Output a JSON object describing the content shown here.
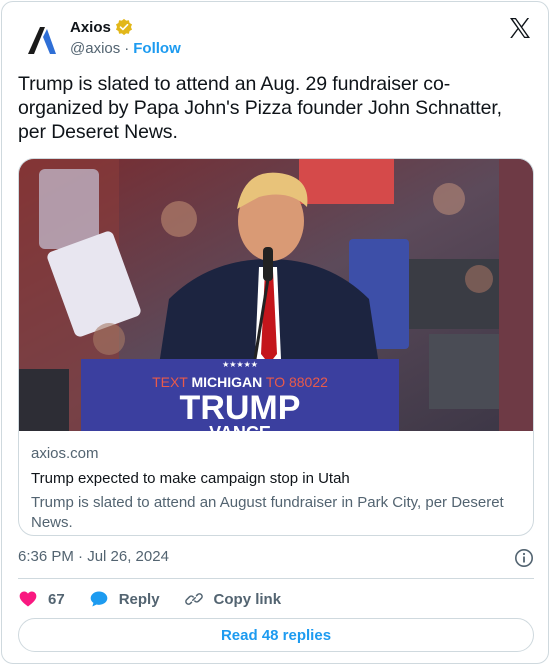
{
  "author": {
    "display_name": "Axios",
    "handle": "@axios",
    "separator": "·",
    "follow_label": "Follow"
  },
  "tweet": {
    "text": "Trump is slated to attend an Aug. 29 fundraiser co-organized by Papa John's Pizza founder John Schnatter, per Deseret News."
  },
  "link_card": {
    "image_sign": {
      "top_line_prefix": "TEXT ",
      "top_line_bold": "MICHIGAN",
      "top_line_suffix": " TO 88022",
      "main": "TRUMP",
      "sub": "VANCE",
      "stars": "★★★★★"
    },
    "domain": "axios.com",
    "title": "Trump expected to make campaign stop in Utah",
    "description": "Trump is slated to attend an August fundraiser in Park City, per Deseret News."
  },
  "timestamp": "6:36 PM · Jul 26, 2024",
  "actions": {
    "like_count": "67",
    "reply_label": "Reply",
    "copy_label": "Copy link"
  },
  "read_replies_label": "Read 48 replies",
  "colors": {
    "accent": "#1d9bf0",
    "like": "#f91880",
    "text_secondary": "#536471",
    "verified": "#e2b719"
  },
  "icons": [
    "axios-logo-icon",
    "verified-badge-icon",
    "x-logo-icon",
    "info-icon",
    "heart-icon",
    "reply-bubble-icon",
    "link-icon"
  ]
}
